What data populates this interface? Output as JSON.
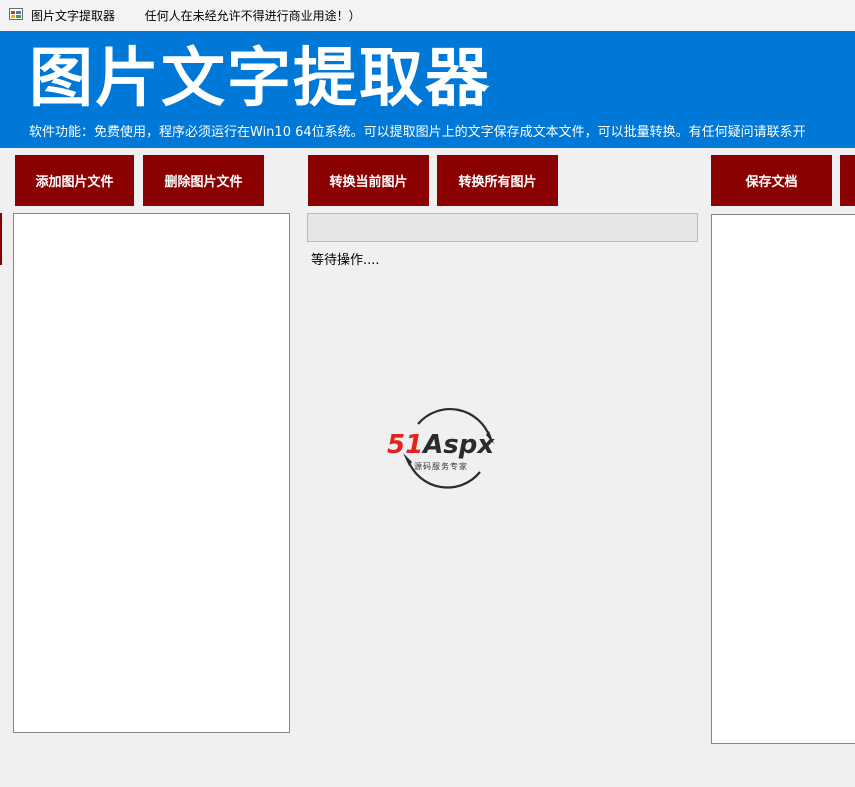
{
  "window": {
    "title": "图片文字提取器",
    "notice": "任何人在未经允许不得进行商业用途！）"
  },
  "header": {
    "title": "图片文字提取器",
    "description": "软件功能：免费使用，程序必须运行在Win10 64位系统。可以提取图片上的文字保存成文本文件，可以批量转换。有任何疑问请联系开"
  },
  "toolbar": {
    "add_images": "添加图片文件",
    "delete_images": "删除图片文件",
    "convert_current": "转换当前图片",
    "convert_all": "转换所有图片",
    "save_document": "保存文档"
  },
  "progress": {
    "value": 0
  },
  "status": {
    "text": "等待操作...."
  },
  "watermark": {
    "brand_red": "51",
    "brand_dark": "Aspx",
    "tagline": "源码服务专家"
  },
  "colors": {
    "header_bg": "#0078d7",
    "button_bg": "#8b0000",
    "brand_red": "#e3231c",
    "brand_green": "#23a03b"
  }
}
